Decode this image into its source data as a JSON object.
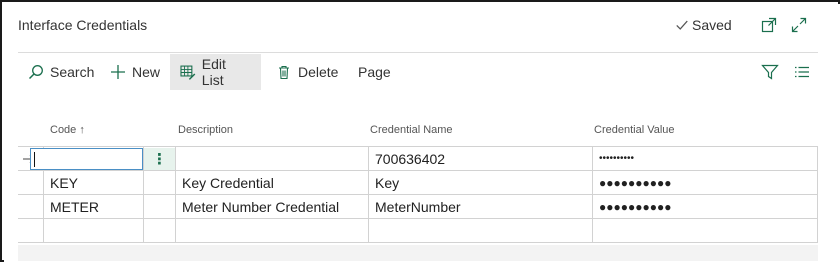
{
  "page": {
    "title": "Interface Credentials",
    "saved_label": "Saved"
  },
  "icons": {
    "saved": "checkmark-icon",
    "open_new": "open-in-new-window-icon",
    "expand": "expand-icon",
    "search": "search-icon",
    "new": "plus-icon",
    "edit_list": "edit-list-icon",
    "delete": "trash-icon",
    "filter": "filter-icon",
    "list": "list-view-icon",
    "row_indicator": "arrow-right-icon",
    "row_menu": "more-vertical-icon"
  },
  "actions": {
    "search": "Search",
    "new": "New",
    "edit_list": "Edit List",
    "delete": "Delete",
    "page": "Page"
  },
  "grid": {
    "columns": [
      "Code ↑",
      "Description",
      "Credential Name",
      "Credential Value"
    ],
    "rows": [
      {
        "code": "",
        "description": "",
        "credential_name": "700636402",
        "credential_value": "••••••••••"
      },
      {
        "code": "KEY",
        "description": "Key Credential",
        "credential_name": "Key",
        "credential_value": "●●●●●●●●●●"
      },
      {
        "code": "METER",
        "description": "Meter Number Credential",
        "credential_name": "MeterNumber",
        "credential_value": "●●●●●●●●●●"
      },
      {
        "code": "",
        "description": "",
        "credential_name": "",
        "credential_value": ""
      }
    ]
  },
  "colors": {
    "accent": "#1b6f4e",
    "focus_border": "#4a8fc5",
    "active_action_bg": "#e8e8e8"
  }
}
